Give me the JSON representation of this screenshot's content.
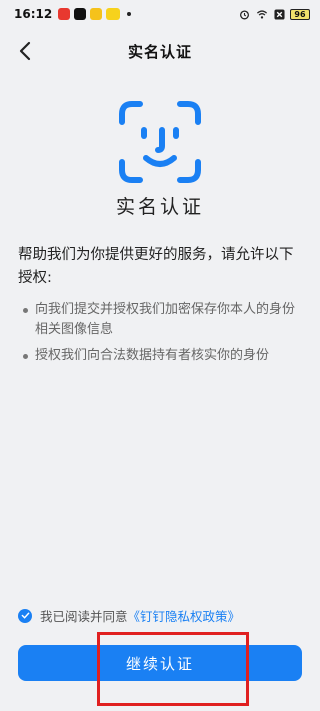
{
  "status_bar": {
    "time": "16:12",
    "battery": "96",
    "apps": [
      "xiaohongshu-icon",
      "tiktok-icon",
      "meituan-icon",
      "app-icon"
    ],
    "right_icons": [
      "alarm-icon",
      "wifi-icon",
      "sim-off-icon",
      "battery-icon"
    ]
  },
  "header": {
    "title": "实名认证"
  },
  "hero": {
    "icon": "face-id-icon",
    "title": "实名认证",
    "accent": "#1a80f3"
  },
  "intro": {
    "text": "帮助我们为你提供更好的服务，请允许以下授权:"
  },
  "permissions": [
    "向我们提交并授权我们加密保存你本人的身份相关图像信息",
    "授权我们向合法数据持有者核实你的身份"
  ],
  "agreement": {
    "prefix": "我已阅读并同意",
    "link": "《钉钉隐私权政策》"
  },
  "actions": {
    "continue_label": "继续认证"
  }
}
